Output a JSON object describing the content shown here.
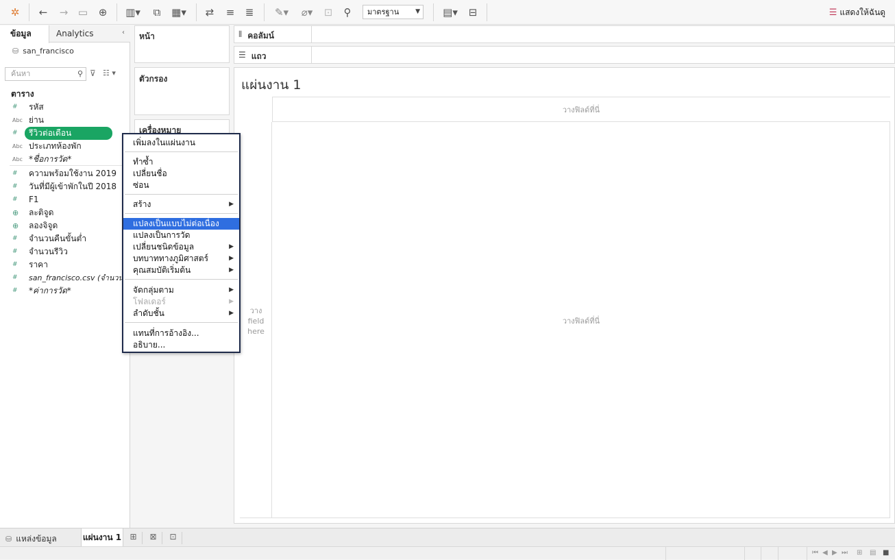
{
  "toolbar": {
    "mark_type_select": "มาตรฐาน",
    "show_me_label": "แสดงให้ฉันดู"
  },
  "data_pane": {
    "tab_data": "ข้อมูล",
    "tab_analytics": "Analytics",
    "datasource": "san_francisco",
    "search_placeholder": "ค้นหา",
    "section": "ตาราง",
    "fields": [
      {
        "icon": "#",
        "name": "รหัส"
      },
      {
        "icon": "Abc",
        "name": "ย่าน"
      },
      {
        "icon": "#",
        "name": "รีวิวต่อเดือน"
      },
      {
        "icon": "Abc",
        "name": "ประเภทห้องพัก"
      },
      {
        "icon": "Abc",
        "name": "*ชื่อการวัด*"
      },
      {
        "icon": "#",
        "name": "ความพร้อมใช้งาน 2019"
      },
      {
        "icon": "#",
        "name": "วันที่มีผู้เข้าพักในปี 2018"
      },
      {
        "icon": "#",
        "name": "F1"
      },
      {
        "icon": "globe",
        "name": "ละติจูด"
      },
      {
        "icon": "globe",
        "name": "ลองจิจูด"
      },
      {
        "icon": "#",
        "name": "จำนวนคืนขั้นต่ำ"
      },
      {
        "icon": "#",
        "name": "จำนวนรีวิว"
      },
      {
        "icon": "#",
        "name": "ราคา"
      },
      {
        "icon": "#",
        "name": "san_francisco.csv (จำนวน)"
      },
      {
        "icon": "#",
        "name": "*ค่าการวัด*"
      }
    ]
  },
  "shelves": {
    "pages": "หน้า",
    "filters": "ตัวกรอง",
    "marks": "เครื่องหมาย",
    "columns": "คอลัมน์",
    "rows": "แถว"
  },
  "sheet": {
    "title": "แผ่นงาน 1",
    "drop_top": "วางฟิลด์ที่นี่",
    "drop_left_1": "วาง",
    "drop_left_2": "field",
    "drop_left_3": "here",
    "drop_main": "วางฟิลด์ที่นี่"
  },
  "context_menu": {
    "add_to_sheet": "เพิ่มลงในแผ่นงาน",
    "duplicate": "ทำซ้ำ",
    "rename": "เปลี่ยนชื่อ",
    "hide": "ซ่อน",
    "create": "สร้าง",
    "convert_discrete": "แปลงเป็นแบบไม่ต่อเนื่อง",
    "convert_measure": "แปลงเป็นการวัด",
    "change_data_type": "เปลี่ยนชนิดข้อมูล",
    "geographic_role": "บทบาททางภูมิศาสตร์",
    "default_properties": "คุณสมบัติเริ่มต้น",
    "group_by": "จัดกลุ่มตาม",
    "folders": "โฟลเดอร์",
    "hierarchy": "ลำดับชั้น",
    "replace_references": "แทนที่การอ้างอิง...",
    "describe": "อธิบาย..."
  },
  "bottom_tabs": {
    "datasource_tab": "แหล่งข้อมูล",
    "sheet_tab": "แผ่นงาน 1"
  }
}
